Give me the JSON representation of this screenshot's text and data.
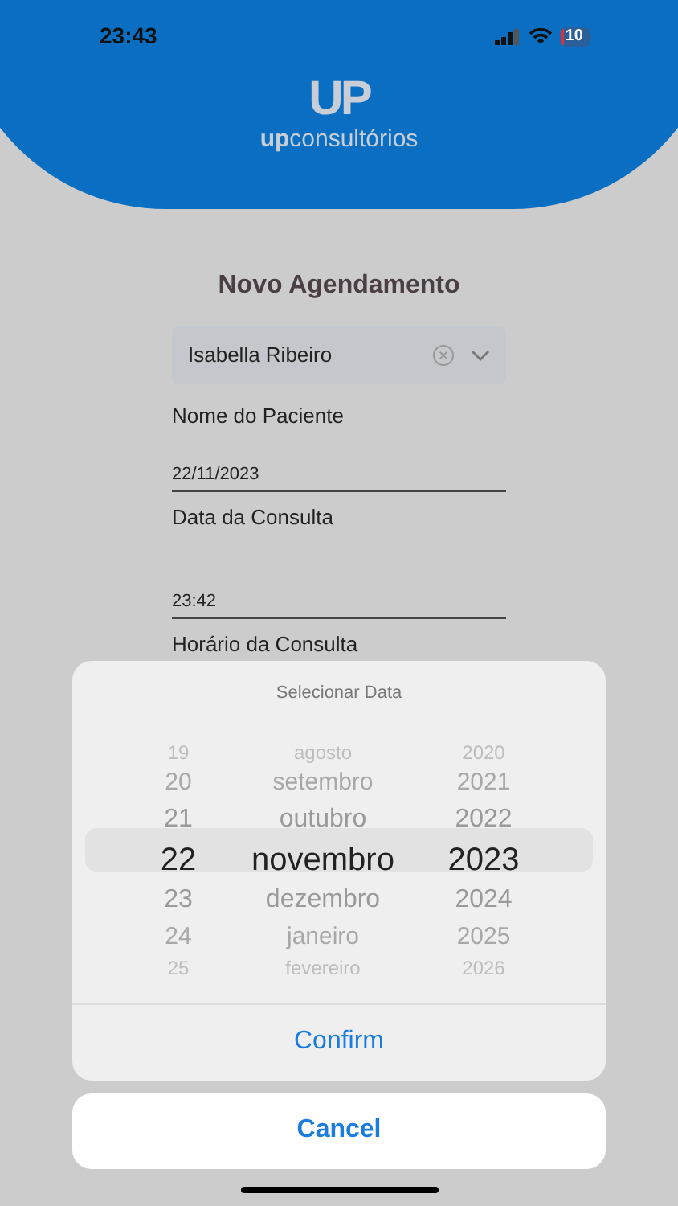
{
  "status_bar": {
    "time": "23:43",
    "battery": "10"
  },
  "logo": {
    "mark": "UP",
    "word_bold": "up",
    "word_light": "consultórios"
  },
  "form": {
    "title": "Novo Agendamento",
    "fields": [
      {
        "kind": "select",
        "value": "Isabella Ribeiro",
        "label": "Nome do Paciente"
      },
      {
        "kind": "input",
        "value": "22/11/2023",
        "label": "Data da Consulta"
      },
      {
        "kind": "input",
        "value": "23:42",
        "label": "Horário da Consulta"
      }
    ]
  },
  "picker": {
    "title": "Selecionar Data",
    "columns": [
      {
        "items": [
          {
            "label": "19",
            "selected": false
          },
          {
            "label": "20",
            "selected": false
          },
          {
            "label": "21",
            "selected": false
          },
          {
            "label": "22",
            "selected": true
          },
          {
            "label": "23",
            "selected": false
          },
          {
            "label": "24",
            "selected": false
          },
          {
            "label": "25",
            "selected": false
          }
        ]
      },
      {
        "items": [
          {
            "label": "agosto",
            "selected": false
          },
          {
            "label": "setembro",
            "selected": false
          },
          {
            "label": "outubro",
            "selected": false
          },
          {
            "label": "novembro",
            "selected": true
          },
          {
            "label": "dezembro",
            "selected": false
          },
          {
            "label": "janeiro",
            "selected": false
          },
          {
            "label": "fevereiro",
            "selected": false
          }
        ]
      },
      {
        "items": [
          {
            "label": "2020",
            "selected": false
          },
          {
            "label": "2021",
            "selected": false
          },
          {
            "label": "2022",
            "selected": false
          },
          {
            "label": "2023",
            "selected": true
          },
          {
            "label": "2024",
            "selected": false
          },
          {
            "label": "2025",
            "selected": false
          },
          {
            "label": "2026",
            "selected": false
          }
        ]
      }
    ],
    "confirm": "Confirm",
    "cancel": "Cancel"
  }
}
